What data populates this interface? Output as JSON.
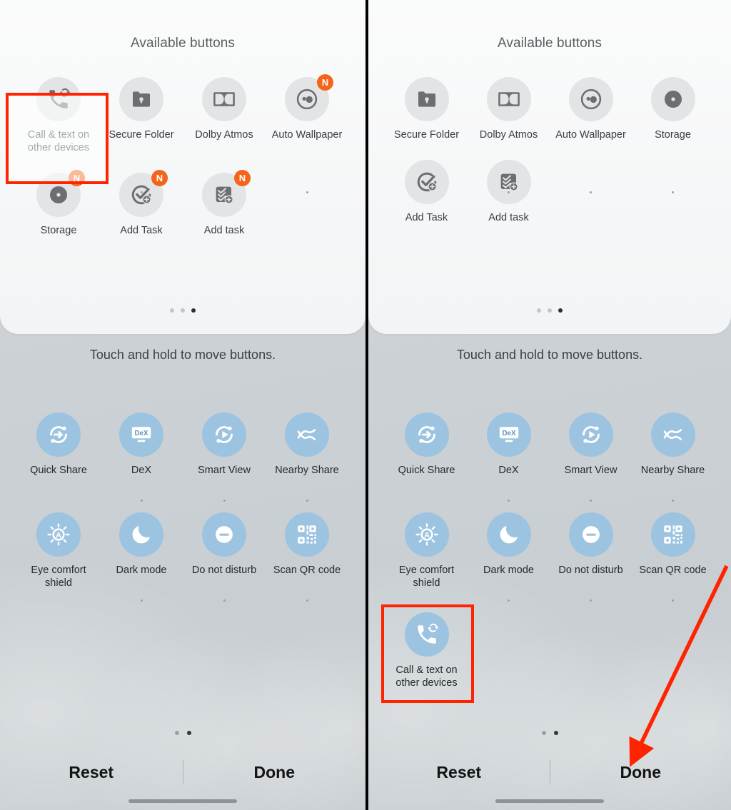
{
  "accent": {
    "highlight_red": "#ff2400",
    "badge_orange": "#f4651b",
    "icon_blue": "#9cc3e0",
    "icon_grey": "#e2e4e5"
  },
  "panels": [
    {
      "id": "before",
      "sheet": {
        "title": "Available buttons",
        "page_dots": {
          "count": 3,
          "active_index": 2
        },
        "items": [
          {
            "label": "Call & text on other devices",
            "icon": "call-sync-icon",
            "badge": "",
            "highlighted": true
          },
          {
            "label": "Secure Folder",
            "icon": "folder-lock-icon",
            "badge": ""
          },
          {
            "label": "Dolby Atmos",
            "icon": "dolby-atmos-icon",
            "badge": ""
          },
          {
            "label": "Auto Wallpaper",
            "icon": "auto-wallpaper-icon",
            "badge": "N"
          },
          {
            "label": "Storage",
            "icon": "storage-disc-icon",
            "badge": "N"
          },
          {
            "label": "Add Task",
            "icon": "add-task-check-icon",
            "badge": "N"
          },
          {
            "label": "Add task",
            "icon": "add-task-stack-icon",
            "badge": "N"
          }
        ]
      },
      "hint": "Touch and hold to move buttons.",
      "active_items": [
        {
          "label": "Quick Share",
          "icon": "quick-share-icon"
        },
        {
          "label": "DeX",
          "icon": "dex-icon"
        },
        {
          "label": "Smart View",
          "icon": "smart-view-icon"
        },
        {
          "label": "Nearby Share",
          "icon": "nearby-share-icon"
        },
        {
          "label": "Eye comfort shield",
          "icon": "eye-comfort-shield-icon"
        },
        {
          "label": "Dark mode",
          "icon": "dark-mode-moon-icon"
        },
        {
          "label": "Do not disturb",
          "icon": "do-not-disturb-icon"
        },
        {
          "label": "Scan QR code",
          "icon": "scan-qr-code-icon"
        }
      ],
      "third_row": [],
      "page_dots": {
        "count": 2,
        "active_index": 1
      },
      "actions": {
        "reset": "Reset",
        "done": "Done"
      }
    },
    {
      "id": "after",
      "sheet": {
        "title": "Available buttons",
        "page_dots": {
          "count": 3,
          "active_index": 2
        },
        "items": [
          {
            "label": "Secure Folder",
            "icon": "folder-lock-icon",
            "badge": ""
          },
          {
            "label": "Dolby Atmos",
            "icon": "dolby-atmos-icon",
            "badge": ""
          },
          {
            "label": "Auto Wallpaper",
            "icon": "auto-wallpaper-icon",
            "badge": ""
          },
          {
            "label": "Storage",
            "icon": "storage-disc-icon",
            "badge": ""
          },
          {
            "label": "Add Task",
            "icon": "add-task-check-icon",
            "badge": ""
          },
          {
            "label": "Add task",
            "icon": "add-task-stack-icon",
            "badge": ""
          }
        ]
      },
      "hint": "Touch and hold to move buttons.",
      "active_items": [
        {
          "label": "Quick Share",
          "icon": "quick-share-icon"
        },
        {
          "label": "DeX",
          "icon": "dex-icon"
        },
        {
          "label": "Smart View",
          "icon": "smart-view-icon"
        },
        {
          "label": "Nearby Share",
          "icon": "nearby-share-icon"
        },
        {
          "label": "Eye comfort shield",
          "icon": "eye-comfort-shield-icon"
        },
        {
          "label": "Dark mode",
          "icon": "dark-mode-moon-icon"
        },
        {
          "label": "Do not disturb",
          "icon": "do-not-disturb-icon"
        },
        {
          "label": "Scan QR code",
          "icon": "scan-qr-code-icon"
        }
      ],
      "third_row": [
        {
          "label": "Call & text on other devices",
          "icon": "call-sync-icon",
          "highlighted": true
        }
      ],
      "page_dots": {
        "count": 2,
        "active_index": 1
      },
      "actions": {
        "reset": "Reset",
        "done": "Done"
      }
    }
  ]
}
